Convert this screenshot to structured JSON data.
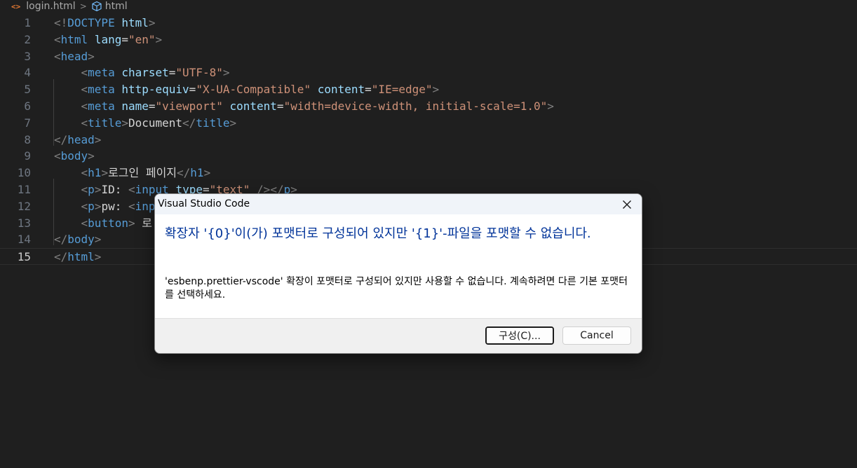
{
  "breadcrumb": {
    "file_label": "login.html",
    "symbol_label": "html",
    "file_icon": "html-file-icon",
    "symbol_icon": "cube-symbol-icon"
  },
  "editor": {
    "current_line": 15,
    "lines": [
      {
        "n": "1",
        "tokens": [
          [
            "br",
            "<!"
          ],
          [
            "tag",
            "DOCTYPE"
          ],
          [
            "txt",
            " "
          ],
          [
            "attr",
            "html"
          ],
          [
            "br",
            ">"
          ]
        ]
      },
      {
        "n": "2",
        "tokens": [
          [
            "br",
            "<"
          ],
          [
            "tag",
            "html"
          ],
          [
            "txt",
            " "
          ],
          [
            "attr",
            "lang"
          ],
          [
            "txt",
            "="
          ],
          [
            "str",
            "\"en\""
          ],
          [
            "br",
            ">"
          ]
        ]
      },
      {
        "n": "3",
        "tokens": [
          [
            "br",
            "<"
          ],
          [
            "tag",
            "head"
          ],
          [
            "br",
            ">"
          ]
        ]
      },
      {
        "n": "4",
        "tokens": [
          [
            "txt",
            "    "
          ],
          [
            "br",
            "<"
          ],
          [
            "tag",
            "meta"
          ],
          [
            "txt",
            " "
          ],
          [
            "attr",
            "charset"
          ],
          [
            "txt",
            "="
          ],
          [
            "str",
            "\"UTF-8\""
          ],
          [
            "br",
            ">"
          ]
        ]
      },
      {
        "n": "5",
        "tokens": [
          [
            "txt",
            "    "
          ],
          [
            "br",
            "<"
          ],
          [
            "tag",
            "meta"
          ],
          [
            "txt",
            " "
          ],
          [
            "attr",
            "http-equiv"
          ],
          [
            "txt",
            "="
          ],
          [
            "str",
            "\"X-UA-Compatible\""
          ],
          [
            "txt",
            " "
          ],
          [
            "attr",
            "content"
          ],
          [
            "txt",
            "="
          ],
          [
            "str",
            "\"IE=edge\""
          ],
          [
            "br",
            ">"
          ]
        ]
      },
      {
        "n": "6",
        "tokens": [
          [
            "txt",
            "    "
          ],
          [
            "br",
            "<"
          ],
          [
            "tag",
            "meta"
          ],
          [
            "txt",
            " "
          ],
          [
            "attr",
            "name"
          ],
          [
            "txt",
            "="
          ],
          [
            "str",
            "\"viewport\""
          ],
          [
            "txt",
            " "
          ],
          [
            "attr",
            "content"
          ],
          [
            "txt",
            "="
          ],
          [
            "str",
            "\"width=device-width, initial-scale=1.0\""
          ],
          [
            "br",
            ">"
          ]
        ]
      },
      {
        "n": "7",
        "tokens": [
          [
            "txt",
            "    "
          ],
          [
            "br",
            "<"
          ],
          [
            "tag",
            "title"
          ],
          [
            "br",
            ">"
          ],
          [
            "txt",
            "Document"
          ],
          [
            "br",
            "</"
          ],
          [
            "tag",
            "title"
          ],
          [
            "br",
            ">"
          ]
        ]
      },
      {
        "n": "8",
        "tokens": [
          [
            "br",
            "</"
          ],
          [
            "tag",
            "head"
          ],
          [
            "br",
            ">"
          ]
        ]
      },
      {
        "n": "9",
        "tokens": [
          [
            "br",
            "<"
          ],
          [
            "tag",
            "body"
          ],
          [
            "br",
            ">"
          ]
        ]
      },
      {
        "n": "10",
        "tokens": [
          [
            "txt",
            "    "
          ],
          [
            "br",
            "<"
          ],
          [
            "tag",
            "h1"
          ],
          [
            "br",
            ">"
          ],
          [
            "txt",
            "로그인 페이지"
          ],
          [
            "br",
            "</"
          ],
          [
            "tag",
            "h1"
          ],
          [
            "br",
            ">"
          ]
        ]
      },
      {
        "n": "11",
        "tokens": [
          [
            "txt",
            "    "
          ],
          [
            "br",
            "<"
          ],
          [
            "tag",
            "p"
          ],
          [
            "br",
            ">"
          ],
          [
            "txt",
            "ID: "
          ],
          [
            "br",
            "<"
          ],
          [
            "tag",
            "input"
          ],
          [
            "txt",
            " "
          ],
          [
            "attr",
            "type"
          ],
          [
            "txt",
            "="
          ],
          [
            "str",
            "\"text\""
          ],
          [
            "txt",
            " "
          ],
          [
            "br",
            "/></"
          ],
          [
            "tag",
            "p"
          ],
          [
            "br",
            ">"
          ]
        ]
      },
      {
        "n": "12",
        "tokens": [
          [
            "txt",
            "    "
          ],
          [
            "br",
            "<"
          ],
          [
            "tag",
            "p"
          ],
          [
            "br",
            ">"
          ],
          [
            "txt",
            "pw: "
          ],
          [
            "br",
            "<"
          ],
          [
            "tag",
            "inp"
          ]
        ]
      },
      {
        "n": "13",
        "tokens": [
          [
            "txt",
            "    "
          ],
          [
            "br",
            "<"
          ],
          [
            "tag",
            "button"
          ],
          [
            "br",
            ">"
          ],
          [
            "txt",
            " 로"
          ]
        ]
      },
      {
        "n": "14",
        "tokens": [
          [
            "br",
            "</"
          ],
          [
            "tag",
            "body"
          ],
          [
            "br",
            ">"
          ]
        ]
      },
      {
        "n": "15",
        "tokens": [
          [
            "br",
            "</"
          ],
          [
            "tag",
            "html"
          ],
          [
            "br",
            ">"
          ]
        ]
      }
    ]
  },
  "dialog": {
    "title": "Visual Studio Code",
    "close_icon": "close-icon",
    "message": "확장자 '{0}'이(가) 포맷터로 구성되어 있지만 '{1}'-파일을 포맷할 수 없습니다.",
    "detail": "'esbenp.prettier-vscode' 확장이 포맷터로 구성되어 있지만 사용할 수 없습니다. 계속하려면 다른 기본 포맷터를 선택하세요.",
    "configure_label": "구성(C)...",
    "cancel_label": "Cancel"
  },
  "colors": {
    "editor_bg": "#1f1f1f",
    "tag": "#569cd6",
    "attr": "#9cdcfe",
    "string": "#ce9178",
    "bracket": "#808080",
    "text": "#d4d4d4",
    "dialog_message": "#003399"
  }
}
